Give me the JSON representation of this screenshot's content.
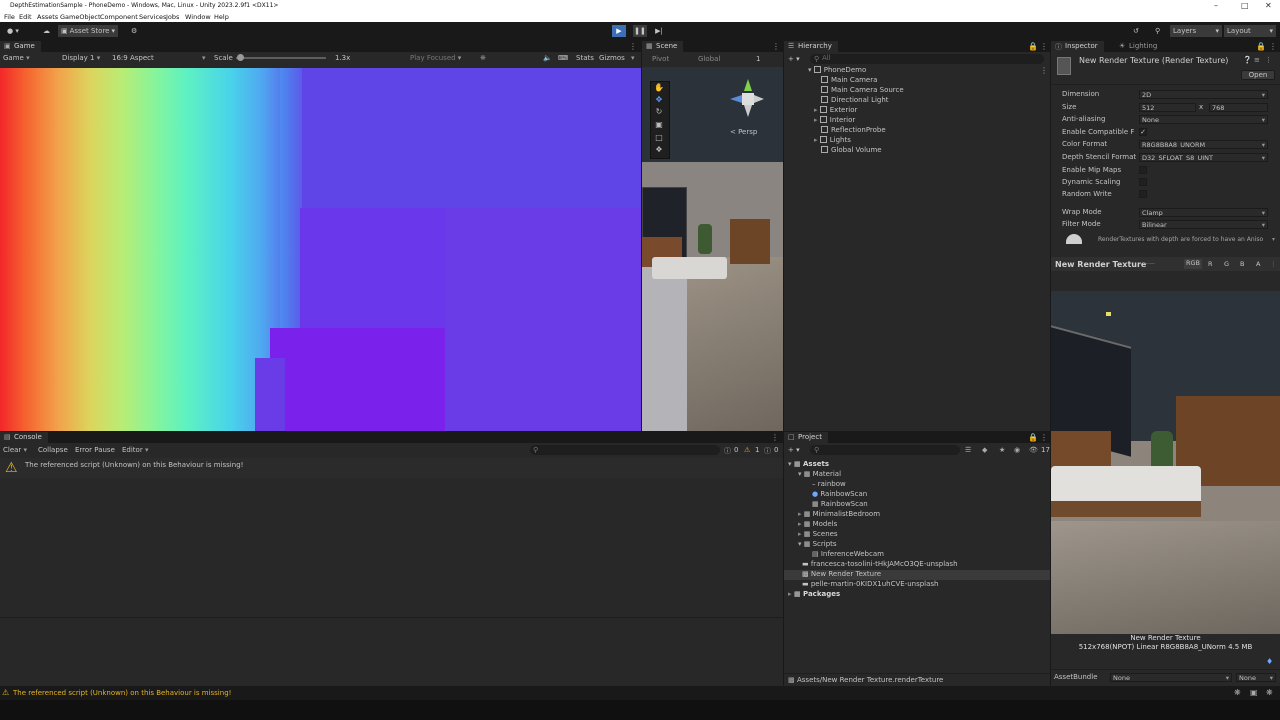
{
  "window": {
    "title": "DepthEstimationSample - PhoneDemo - Windows, Mac, Linux - Unity 2023.2.9f1 <DX11>"
  },
  "menu": [
    "File",
    "Edit",
    "Assets",
    "GameObject",
    "Component",
    "Services",
    "Jobs",
    "Window",
    "Help"
  ],
  "toolbar": {
    "asset_store": "Asset Store",
    "layers": "Layers",
    "layout": "Layout"
  },
  "game_view": {
    "tab": "Game",
    "mode": "Game",
    "display": "Display 1",
    "aspect": "16:9 Aspect",
    "scale_label": "Scale",
    "scale_value": "1.3x",
    "play_focused": "Play Focused",
    "stats": "Stats",
    "gizmos": "Gizmos"
  },
  "scene_view": {
    "tab": "Scene",
    "pivot": "Pivot",
    "global": "Global",
    "grid_num": "1",
    "persp": "< Persp",
    "search_placeholder": "All"
  },
  "hierarchy": {
    "tab": "Hierarchy",
    "search_placeholder": "All",
    "root": "PhoneDemo",
    "items": [
      {
        "label": "Main Camera",
        "expandable": false
      },
      {
        "label": "Main Camera Source",
        "expandable": false
      },
      {
        "label": "Directional Light",
        "expandable": false
      },
      {
        "label": "Exterior",
        "expandable": true
      },
      {
        "label": "Interior",
        "expandable": true
      },
      {
        "label": "ReflectionProbe",
        "expandable": false
      },
      {
        "label": "Lights",
        "expandable": true
      },
      {
        "label": "Global Volume",
        "expandable": false
      }
    ]
  },
  "inspector": {
    "tab": "Inspector",
    "tab2": "Lighting",
    "title": "New Render Texture (Render Texture)",
    "open": "Open",
    "dimension_label": "Dimension",
    "dimension": "2D",
    "size_label": "Size",
    "size_w": "512",
    "size_x": "x",
    "size_h": "768",
    "aa_label": "Anti-aliasing",
    "aa": "None",
    "compat_label": "Enable Compatible F",
    "color_format_label": "Color Format",
    "color_format": "R8G8B8A8_UNORM",
    "depth_label": "Depth Stencil Format",
    "depth": "D32_SFLOAT_S8_UINT",
    "mip_label": "Enable Mip Maps",
    "dyn_label": "Dynamic Scaling",
    "rw_label": "Random Write",
    "wrap_label": "Wrap Mode",
    "wrap": "Clamp",
    "filter_label": "Filter Mode",
    "filter": "Bilinear",
    "info": "RenderTextures with depth are forced to have an Aniso",
    "preview_title": "New Render Texture",
    "channels": [
      "RGB",
      "R",
      "G",
      "B",
      "A"
    ],
    "preview_name": "New Render Texture",
    "preview_info": "512x768(NPOT) Linear  R8G8B8A8_UNorm  4.5 MB",
    "assetbundle_label": "AssetBundle",
    "assetbundle": "None",
    "assetbundle_variant": "None"
  },
  "console": {
    "tab": "Console",
    "clear": "Clear",
    "collapse": "Collapse",
    "error_pause": "Error Pause",
    "editor": "Editor",
    "count_info": "0",
    "count_warn": "1",
    "count_err": "0",
    "message": "The referenced script (Unknown) on this Behaviour is missing!"
  },
  "project": {
    "tab": "Project",
    "count": "17",
    "tree": [
      {
        "label": "Assets",
        "depth": 0,
        "kind": "folder-open",
        "bold": true
      },
      {
        "label": "Material",
        "depth": 1,
        "kind": "folder-open"
      },
      {
        "label": "rainbow",
        "depth": 2,
        "kind": "file"
      },
      {
        "label": "RainbowScan",
        "depth": 2,
        "kind": "material"
      },
      {
        "label": "RainbowScan",
        "depth": 2,
        "kind": "shader"
      },
      {
        "label": "MinimalistBedroom",
        "depth": 1,
        "kind": "folder"
      },
      {
        "label": "Models",
        "depth": 1,
        "kind": "folder"
      },
      {
        "label": "Scenes",
        "depth": 1,
        "kind": "folder"
      },
      {
        "label": "Scripts",
        "depth": 1,
        "kind": "folder-open"
      },
      {
        "label": "InferenceWebcam",
        "depth": 2,
        "kind": "script"
      },
      {
        "label": "francesca-tosolini-tHkJAMcO3QE-unsplash",
        "depth": 1,
        "kind": "image"
      },
      {
        "label": "New Render Texture",
        "depth": 1,
        "kind": "rendertexture",
        "selected": true
      },
      {
        "label": "pelle-martin-0KIDX1uhCVE-unsplash",
        "depth": 1,
        "kind": "image"
      },
      {
        "label": "Packages",
        "depth": 0,
        "kind": "folder",
        "bold": true
      }
    ],
    "path": "Assets/New Render Texture.renderTexture"
  },
  "status_bar": {
    "message": "The referenced script (Unknown) on this Behaviour is missing!"
  }
}
